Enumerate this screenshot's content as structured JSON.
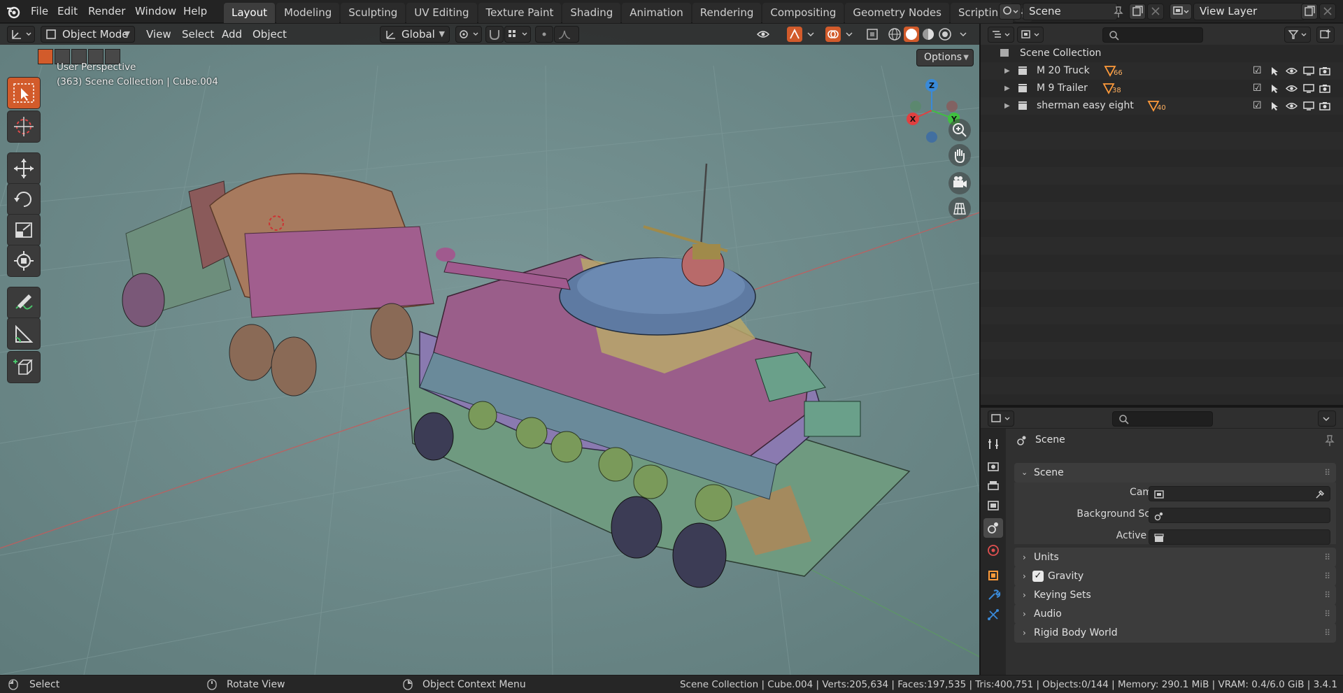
{
  "topbar": {
    "menus": [
      "File",
      "Edit",
      "Render",
      "Window",
      "Help"
    ],
    "workspaces": [
      "Layout",
      "Modeling",
      "Sculpting",
      "UV Editing",
      "Texture Paint",
      "Shading",
      "Animation",
      "Rendering",
      "Compositing",
      "Geometry Nodes",
      "Scripting"
    ],
    "active_workspace": "Layout",
    "scene_name": "Scene",
    "view_layer_name": "View Layer"
  },
  "viewport": {
    "mode": "Object Mode",
    "menus": [
      "View",
      "Select",
      "Add",
      "Object"
    ],
    "transform_orientation": "Global",
    "options_label": "Options",
    "info_line1": "User Perspective",
    "info_line2": "(363) Scene Collection | Cube.004",
    "gizmo_axes": {
      "x": "X",
      "y": "Y",
      "z": "Z"
    },
    "colors": {
      "background": "#6d8a8a",
      "active_tool": "#d25b2b",
      "axis_x": "#e04040",
      "axis_y": "#40c040",
      "axis_z": "#3a8ad8"
    }
  },
  "outliner": {
    "root": "Scene Collection",
    "items": [
      {
        "name": "M 20 Truck",
        "count": "66"
      },
      {
        "name": "M 9 Trailer",
        "count": "38"
      },
      {
        "name": "sherman easy eight",
        "count": "40"
      }
    ]
  },
  "properties": {
    "context_title": "Scene",
    "panels": {
      "scene": {
        "title": "Scene",
        "camera_label": "Camera",
        "background_scene_label": "Background Scene",
        "active_clip_label": "Active Clip"
      },
      "units": "Units",
      "gravity": "Gravity",
      "keying_sets": "Keying Sets",
      "audio": "Audio",
      "rigid_body_world": "Rigid Body World"
    }
  },
  "statusbar": {
    "left_hint": "Select",
    "middle_hint": "Rotate View",
    "right_hint": "Object Context Menu",
    "stats": "Scene Collection | Cube.004 | Verts:205,634 | Faces:197,535 | Tris:400,751 | Objects:0/144 | Memory: 290.1 MiB | VRAM: 0.4/6.0 GiB | 3.4.1"
  }
}
